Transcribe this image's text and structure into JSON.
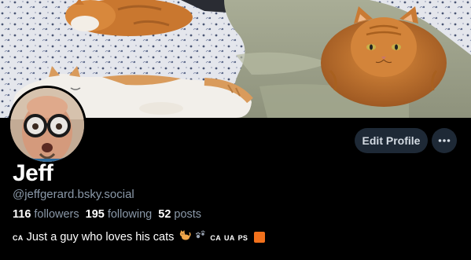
{
  "profile": {
    "display_name": "Jeff",
    "handle": "@jeffgerard.bsky.social",
    "stats": [
      {
        "count": "116",
        "label": "followers"
      },
      {
        "count": "195",
        "label": "following"
      },
      {
        "count": "52",
        "label": "posts"
      }
    ],
    "bio": {
      "flag_prefix": "CA",
      "text": "Just a guy who loves his cats",
      "emoji_cat": "cat-emoji",
      "emoji_paws": "paw-prints-emoji",
      "flags": [
        "CA",
        "UA",
        "PS"
      ],
      "emoji_square": "orange-square-emoji"
    }
  },
  "actions": {
    "edit_profile_label": "Edit Profile",
    "more_icon": "ellipsis-icon"
  },
  "colors": {
    "background": "#000000",
    "button_bg": "#1e2936",
    "muted_text": "#8a98a8",
    "accent_square": "#f2711c"
  }
}
